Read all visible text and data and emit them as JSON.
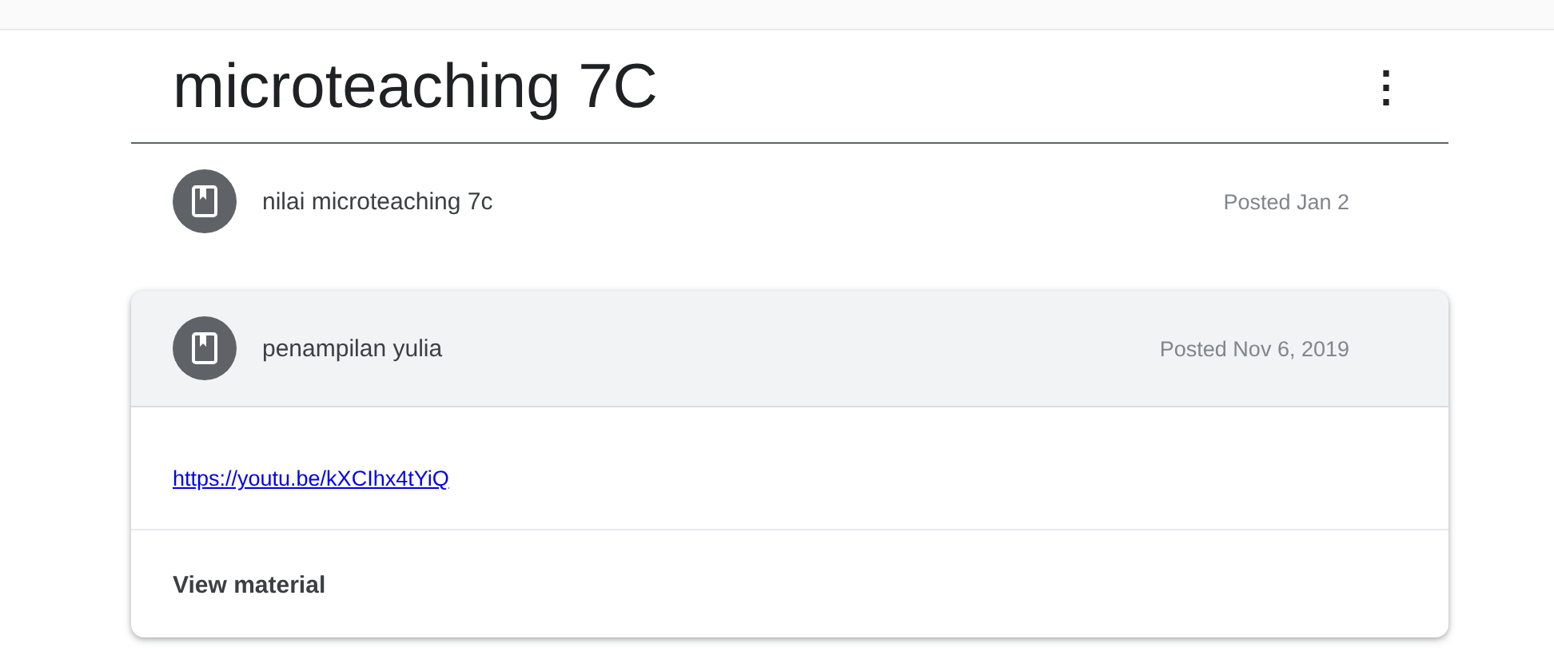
{
  "topic": {
    "title": "microteaching 7C",
    "menu_icon": "⋮"
  },
  "materials": [
    {
      "title": "nilai microteaching 7c",
      "posted": "Posted Jan 2",
      "expanded": false
    },
    {
      "title": "penampilan yulia",
      "posted": "Posted Nov 6, 2019",
      "expanded": true,
      "link": "https://youtu.be/kXCIhx4tYiQ",
      "action": "View material"
    }
  ]
}
